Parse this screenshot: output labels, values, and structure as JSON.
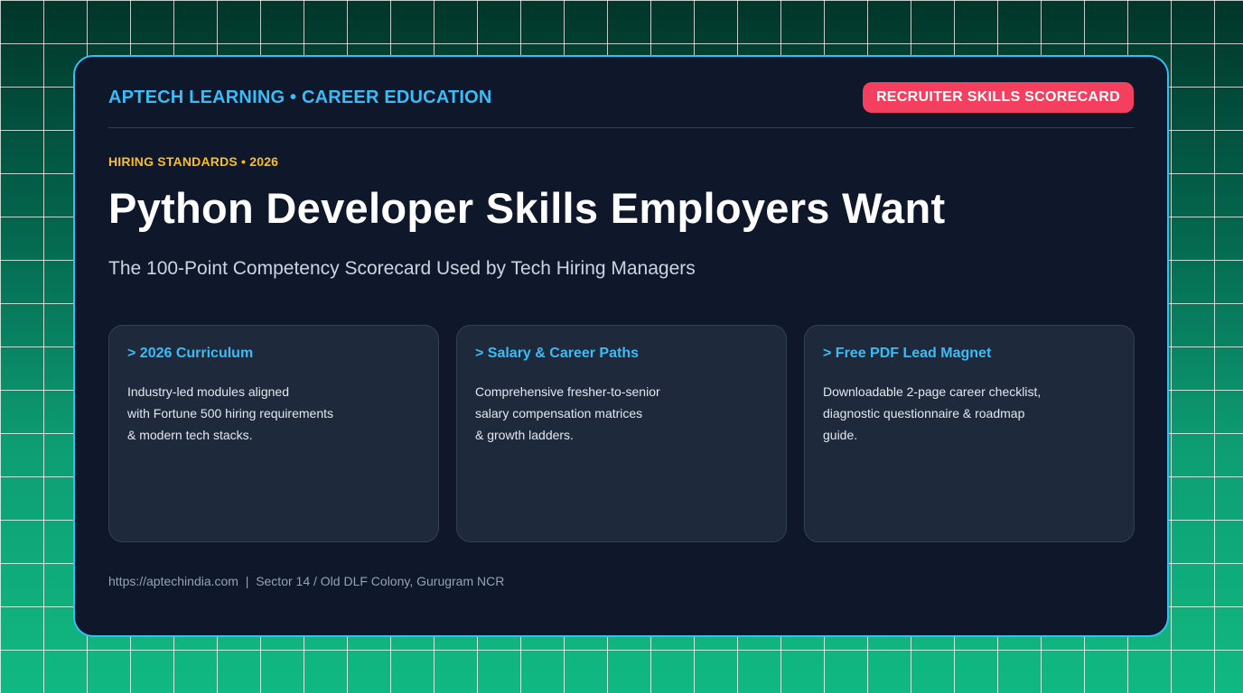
{
  "brand": "APTECH LEARNING • CAREER EDUCATION",
  "badge": "RECRUITER SKILLS SCORECARD",
  "eyebrow": "HIRING STANDARDS • 2026",
  "title": "Python Developer Skills Employers Want",
  "subtitle": "The 100-Point Competency Scorecard Used by Tech Hiring Managers",
  "features": [
    {
      "title": "> 2026 Curriculum",
      "lines": [
        "Industry-led modules aligned",
        "with Fortune 500 hiring requirements",
        "& modern tech stacks."
      ]
    },
    {
      "title": "> Salary & Career Paths",
      "lines": [
        "Comprehensive fresher-to-senior",
        "salary compensation matrices",
        "& growth ladders."
      ]
    },
    {
      "title": "> Free PDF Lead Magnet",
      "lines": [
        "Downloadable 2-page career checklist,",
        "diagnostic questionnaire & roadmap",
        "guide."
      ]
    }
  ],
  "footer": {
    "url": "https://aptechindia.com",
    "separator": "  |  ",
    "address": "Sector 14 / Old DLF Colony, Gurugram NCR"
  },
  "colors": {
    "accent": "#38bdf8",
    "badge": "#f43f5e",
    "eyebrow": "#fbbf24",
    "card_background": "#0f172a",
    "feature_background": "#1e293b",
    "page_gradient_top": "#01352a",
    "page_gradient_bottom": "#10b981"
  }
}
